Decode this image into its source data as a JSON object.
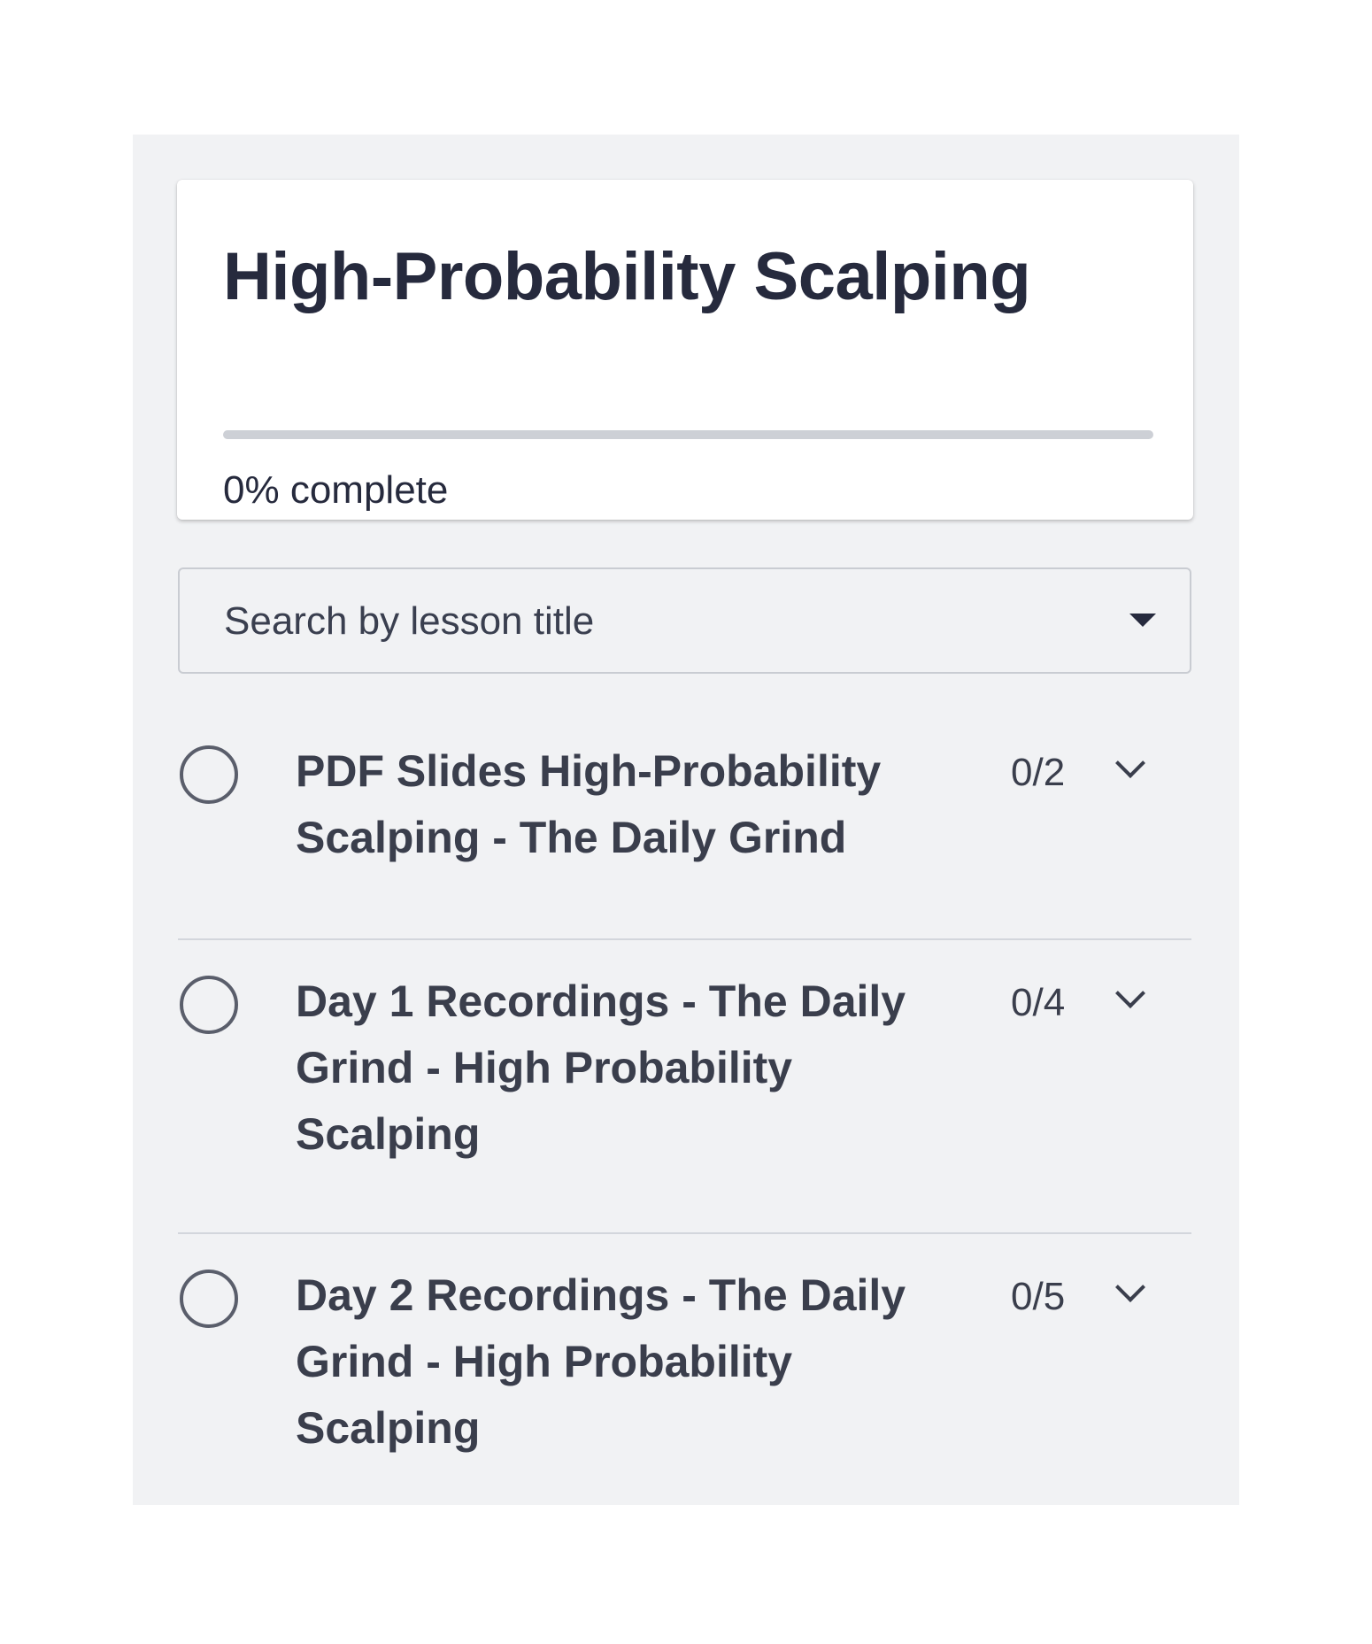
{
  "course": {
    "title": "High-Probability Scalping",
    "progress_percent": 0,
    "progress_text": "0% complete"
  },
  "search": {
    "placeholder": "Search by lesson title",
    "icon": "caret-down-icon"
  },
  "sections": [
    {
      "title": "PDF Slides High-Probability Scalping - The Daily Grind",
      "count": "0/2",
      "status_icon": "empty-circle-icon",
      "toggle_icon": "chevron-down-icon"
    },
    {
      "title": "Day 1 Recordings - The Daily Grind - High Probability Scalping",
      "count": "0/4",
      "status_icon": "empty-circle-icon",
      "toggle_icon": "chevron-down-icon"
    },
    {
      "title": "Day 2 Recordings - The Daily Grind - High Probability Scalping",
      "count": "0/5",
      "status_icon": "empty-circle-icon",
      "toggle_icon": "chevron-down-icon"
    }
  ],
  "colors": {
    "panel_background": "#f1f2f4",
    "text_primary": "#262a3d",
    "progress_track": "#cdd0d6"
  }
}
